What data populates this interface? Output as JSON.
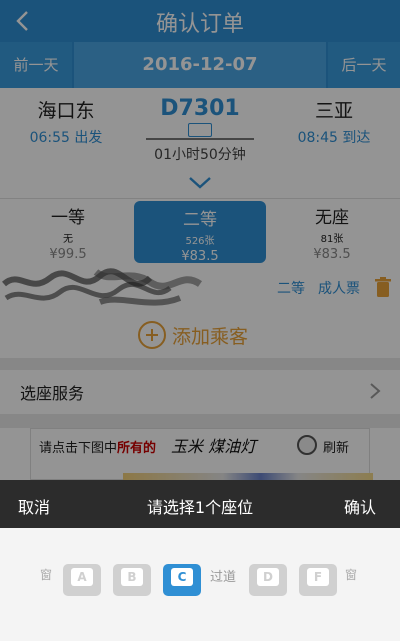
{
  "header": {
    "title": "确认订单",
    "back_icon": "chevron-left-icon"
  },
  "date_bar": {
    "prev_label": "前一天",
    "date": "2016-12-07",
    "next_label": "后一天"
  },
  "train": {
    "from_station": "海口东",
    "depart_time": "06:55 出发",
    "code": "D7301",
    "duration": "01小时50分钟",
    "to_station": "三亚",
    "arrive_time": "08:45 到达"
  },
  "seat_classes": [
    {
      "name": "一等",
      "count": "无",
      "price": "¥99.5",
      "selected": false
    },
    {
      "name": "二等",
      "count": "526张",
      "price": "¥83.5",
      "selected": true
    },
    {
      "name": "无座",
      "count": "81张",
      "price": "¥83.5",
      "selected": false
    }
  ],
  "passenger": {
    "seat_type": "二等",
    "ticket_type": "成人票"
  },
  "add_passenger": {
    "label": "添加乘客"
  },
  "seat_service": {
    "label": "选座服务"
  },
  "captcha": {
    "hint_prefix": "请点击下图中",
    "hint_emphasis": "所有的",
    "words": "玉米  煤油灯",
    "refresh_label": "刷新"
  },
  "action_bar": {
    "cancel_label": "取消",
    "title": "请选择1个座位",
    "confirm_label": "确认"
  },
  "seat_picker": {
    "left_window": "窗",
    "aisle": "过道",
    "right_window": "窗",
    "seats": [
      {
        "label": "A",
        "selected": false
      },
      {
        "label": "B",
        "selected": false
      },
      {
        "label": "C",
        "selected": true
      },
      {
        "label": "D",
        "selected": false
      },
      {
        "label": "F",
        "selected": false
      }
    ]
  },
  "colors": {
    "accent": "#2f8fd4",
    "add_passenger": "#e8a23a",
    "action_bar": "#2c2c2c"
  }
}
